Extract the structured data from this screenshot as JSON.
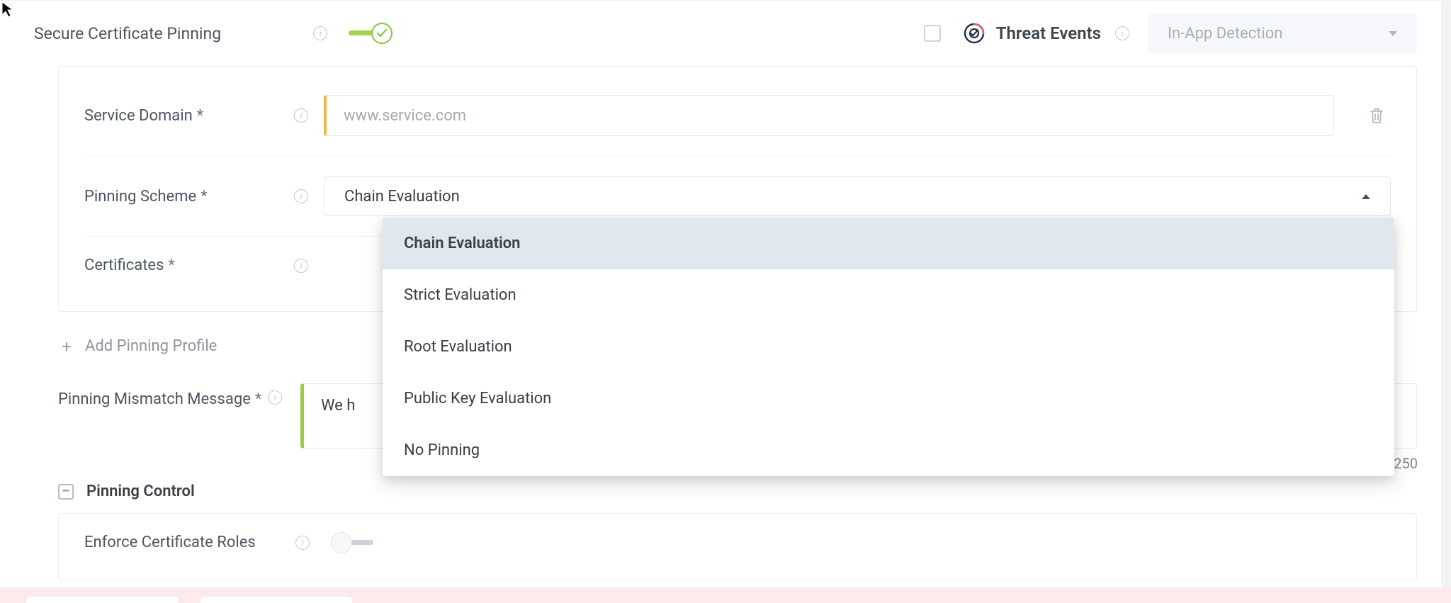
{
  "header": {
    "title": "Secure Certificate Pinning",
    "threat_events_label": "Threat Events",
    "detection_select": "In-App Detection"
  },
  "fields": {
    "service_domain": {
      "label": "Service Domain",
      "placeholder": "www.service.com"
    },
    "pinning_scheme": {
      "label": "Pinning Scheme",
      "selected": "Chain Evaluation"
    },
    "certificates": {
      "label": "Certificates"
    },
    "pinning_mismatch": {
      "label": "Pinning Mismatch Message",
      "value_prefix": "We h",
      "char_count": "250"
    },
    "enforce_roles": {
      "label": "Enforce Certificate Roles"
    }
  },
  "actions": {
    "add_profile": "Add Pinning Profile"
  },
  "pinning_control": {
    "label": "Pinning Control"
  },
  "dropdown": {
    "options": [
      "Chain Evaluation",
      "Strict Evaluation",
      "Root Evaluation",
      "Public Key Evaluation",
      "No Pinning"
    ],
    "selected_index": 0
  },
  "colors": {
    "accent_green": "#8bc53f",
    "accent_yellow": "#e9b949"
  }
}
